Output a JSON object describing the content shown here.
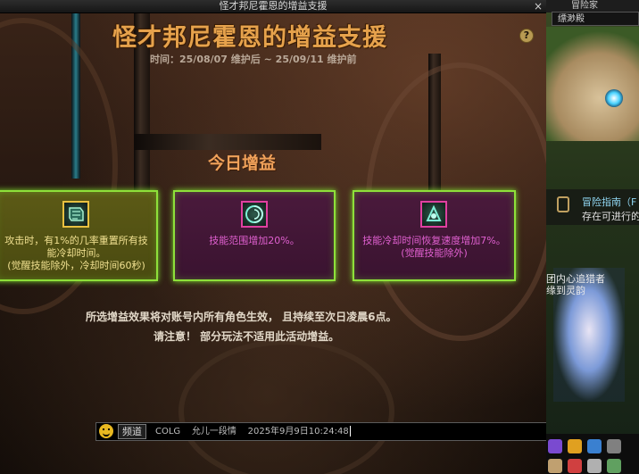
{
  "window": {
    "title": "怪才邦尼霍恩的增益支援",
    "close_label": "×"
  },
  "header": {
    "title": "怪才邦尼霍恩的增益支援",
    "period": "时间：25/08/07 维护后 ~ 25/09/11 维护前",
    "help_label": "?"
  },
  "section": {
    "title": "今日增益"
  },
  "buffs": [
    {
      "text": "攻击时，有1%的几率重置所有技能冷却时间。(觉醒技能除外，冷却时间60秒)",
      "lines": [
        "攻击时，有1%的几率重置所有技",
        "能冷却时间。",
        "(觉醒技能除外，冷却时间60秒)"
      ],
      "icon": "scroll-icon",
      "selected": true
    },
    {
      "text": "技能范围增加20%。",
      "lines": [
        "技能范围增加20%。"
      ],
      "icon": "swirl-icon",
      "selected": false
    },
    {
      "text": "技能冷却时间恢复速度增加7%。(觉醒技能除外)",
      "lines": [
        "技能冷却时间恢复速度增加7%。",
        "(觉醒技能除外)"
      ],
      "icon": "swirl-icon",
      "selected": false
    }
  ],
  "info": {
    "line1": "所选增益效果将对账号内所有角色生效， 且持续至次日凌晨6点。",
    "line2": "请注意！ 部分玩法不适用此活动增益。"
  },
  "chat": {
    "channel": "频道",
    "message": "COLG    允儿一段情    2025年9月9日10:24:48"
  },
  "side": {
    "top_label": "冒险家",
    "location": "缥渺殿",
    "guide_title": "冒险指南（F",
    "guide_text": "存在可进行的",
    "chara_line1": "团内心追猎者",
    "chara_line2": "缘到灵韵"
  },
  "colors": {
    "title": "#e6a24c",
    "card_border": "#8ee03a",
    "card_sel_text": "#f0e090",
    "card_text": "#e060d0"
  }
}
